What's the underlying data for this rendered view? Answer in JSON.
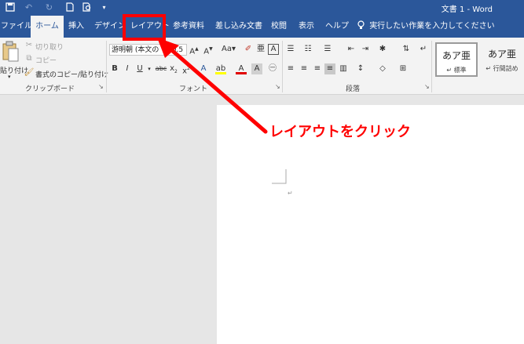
{
  "titlebar": {
    "title": "文書 1  -  Word",
    "quick_access": [
      "save-icon",
      "undo-icon",
      "redo-icon",
      "new-doc-icon",
      "print-preview-icon",
      "customize-icon"
    ]
  },
  "tabs": [
    {
      "label": "ファイル"
    },
    {
      "label": "ホーム"
    },
    {
      "label": "挿入"
    },
    {
      "label": "デザイン"
    },
    {
      "label": "レイアウト"
    },
    {
      "label": "参考資料"
    },
    {
      "label": "差し込み文書"
    },
    {
      "label": "校閲"
    },
    {
      "label": "表示"
    },
    {
      "label": "ヘルプ"
    }
  ],
  "tell_me": "実行したい作業を入力してください",
  "clipboard": {
    "paste_label": "貼り付け",
    "cut_label": "切り取り",
    "copy_label": "コピー",
    "format_painter_label": "書式のコピー/貼り付け",
    "group_label": "クリップボード"
  },
  "font": {
    "font_name": "游明朝 (本文の",
    "font_size": "10.5",
    "group_label": "フォント"
  },
  "paragraph": {
    "group_label": "段落"
  },
  "styles": {
    "items": [
      {
        "preview": "あア亜",
        "name": "↵ 標準"
      },
      {
        "preview": "あア亜",
        "name": "↵ 行間詰め"
      }
    ]
  },
  "annotation": {
    "text": "レイアウトをクリック",
    "color": "#ff0000"
  },
  "colors": {
    "accent": "#2b579a",
    "highlight": "#ff0000"
  }
}
